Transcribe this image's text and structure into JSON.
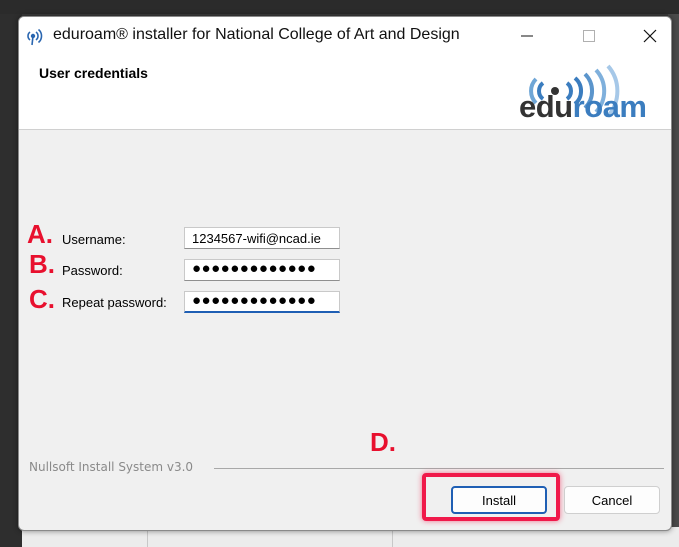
{
  "window": {
    "title": "eduroam® installer for National College of Art and Design",
    "controls": {
      "minimize": "minimize-icon",
      "maximize": "maximize-icon",
      "close": "close-icon"
    }
  },
  "header": {
    "title": "User credentials",
    "logo": {
      "part1": "edu",
      "part2": "roam"
    }
  },
  "form": {
    "fields": [
      {
        "marker": "A.",
        "label": "Username:",
        "value": "1234567-wifi@ncad.ie"
      },
      {
        "marker": "B.",
        "label": "Password:",
        "value": "●●●●●●●●●●●●●"
      },
      {
        "marker": "C.",
        "label": "Repeat password:",
        "value": "●●●●●●●●●●●●●"
      }
    ]
  },
  "annotation_d": "D.",
  "footer": {
    "brand": "Nullsoft Install System v3.0",
    "install_label": "Install",
    "cancel_label": "Cancel"
  },
  "colors": {
    "annotation": "#e8102e",
    "highlight": "#f0194a",
    "logo_edu": "#333333",
    "logo_roam": "#3b7dbf",
    "focus": "#1f5fb4"
  }
}
